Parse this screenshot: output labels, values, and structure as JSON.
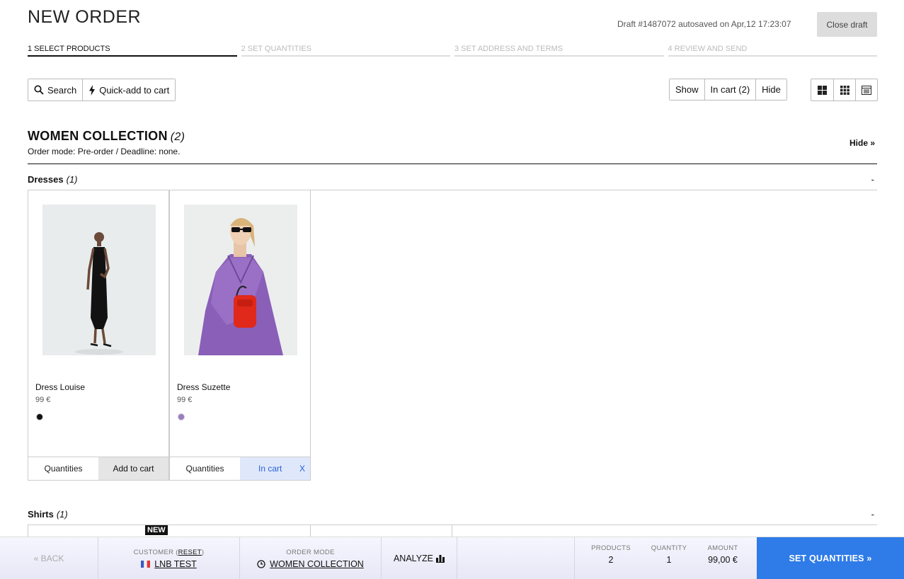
{
  "page": {
    "title": "NEW ORDER"
  },
  "draft": {
    "autosave_text": "Draft #1487072 autosaved on Apr,12 17:23:07",
    "close_label": "Close draft"
  },
  "steps": [
    {
      "label": "1 SELECT PRODUCTS",
      "active": true
    },
    {
      "label": "2 SET QUANTITIES",
      "active": false
    },
    {
      "label": "3 SET ADDRESS AND TERMS",
      "active": false
    },
    {
      "label": "4 REVIEW AND SEND",
      "active": false
    }
  ],
  "toolbar": {
    "search_label": "Search",
    "quick_add_label": "Quick-add to cart",
    "filter_show": "Show",
    "filter_in_cart": "In cart (2)",
    "filter_hide": "Hide"
  },
  "collection": {
    "title": "WOMEN COLLECTION",
    "count": "(2)",
    "order_mode_line": "Order mode: Pre-order / Deadline: none.",
    "hide_label": "Hide »"
  },
  "categories": [
    {
      "name": "Dresses",
      "count": "(1)",
      "toggle": "-"
    },
    {
      "name": "Shirts",
      "count": "(1)",
      "toggle": "-"
    }
  ],
  "products": [
    {
      "name": "Dress Louise",
      "price": "99 €",
      "swatch": "#111111",
      "qty_label": "Quantities",
      "action_label": "Add to cart",
      "in_cart": false
    },
    {
      "name": "Dress Suzette",
      "price": "99 €",
      "swatch": "#9b7cc2",
      "qty_label": "Quantities",
      "action_label": "In cart",
      "remove_label": "X",
      "in_cart": true
    }
  ],
  "badge": {
    "new": "NEW"
  },
  "bottom": {
    "back_label": "« BACK",
    "customer_label": "CUSTOMER (",
    "customer_reset": "RESET",
    "customer_label_end": ")",
    "customer_value": "LNB TEST",
    "order_mode_label": "ORDER MODE",
    "order_mode_value": "WOMEN COLLECTION",
    "analyze_label": "ANALYZE",
    "products_label": "PRODUCTS",
    "products_value": "2",
    "quantity_label": "QUANTITY",
    "quantity_value": "1",
    "amount_label": "AMOUNT",
    "amount_value": "99,00 €",
    "cta_label": "SET QUANTITIES »"
  },
  "colors": {
    "accent": "#2f7be8",
    "in_cart_bg": "#dfe8fb",
    "in_cart_text": "#2a62d8"
  }
}
